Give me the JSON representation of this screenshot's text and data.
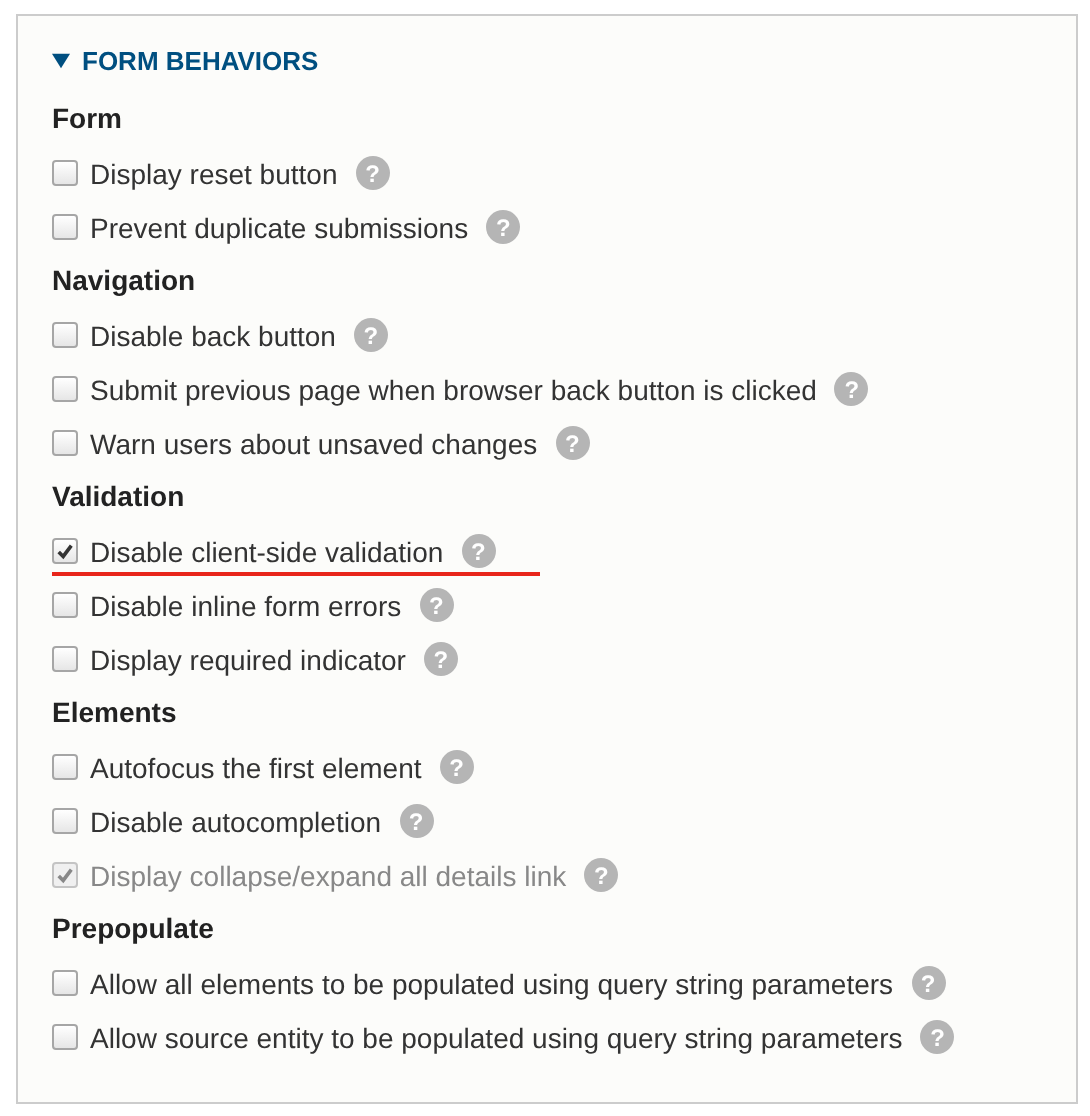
{
  "panel": {
    "title": "FORM BEHAVIORS",
    "expanded": true,
    "groups": [
      {
        "heading": "Form",
        "items": [
          {
            "label": "Display reset button",
            "checked": false,
            "disabled": false,
            "underlined": false,
            "help": "?"
          },
          {
            "label": "Prevent duplicate submissions",
            "checked": false,
            "disabled": false,
            "underlined": false,
            "help": "?"
          }
        ]
      },
      {
        "heading": "Navigation",
        "items": [
          {
            "label": "Disable back button",
            "checked": false,
            "disabled": false,
            "underlined": false,
            "help": "?"
          },
          {
            "label": "Submit previous page when browser back button is clicked",
            "checked": false,
            "disabled": false,
            "underlined": false,
            "help": "?"
          },
          {
            "label": "Warn users about unsaved changes",
            "checked": false,
            "disabled": false,
            "underlined": false,
            "help": "?"
          }
        ]
      },
      {
        "heading": "Validation",
        "items": [
          {
            "label": "Disable client-side validation",
            "checked": true,
            "disabled": false,
            "underlined": true,
            "help": "?"
          },
          {
            "label": "Disable inline form errors",
            "checked": false,
            "disabled": false,
            "underlined": false,
            "help": "?"
          },
          {
            "label": "Display required indicator",
            "checked": false,
            "disabled": false,
            "underlined": false,
            "help": "?"
          }
        ]
      },
      {
        "heading": "Elements",
        "items": [
          {
            "label": "Autofocus the first element",
            "checked": false,
            "disabled": false,
            "underlined": false,
            "help": "?"
          },
          {
            "label": "Disable autocompletion",
            "checked": false,
            "disabled": false,
            "underlined": false,
            "help": "?"
          },
          {
            "label": "Display collapse/expand all details link",
            "checked": true,
            "disabled": true,
            "underlined": false,
            "help": "?"
          }
        ]
      },
      {
        "heading": "Prepopulate",
        "items": [
          {
            "label": "Allow all elements to be populated using query string parameters",
            "checked": false,
            "disabled": false,
            "underlined": false,
            "help": "?"
          },
          {
            "label": "Allow source entity to be populated using query string parameters",
            "checked": false,
            "disabled": false,
            "underlined": false,
            "help": "?"
          }
        ]
      }
    ]
  }
}
